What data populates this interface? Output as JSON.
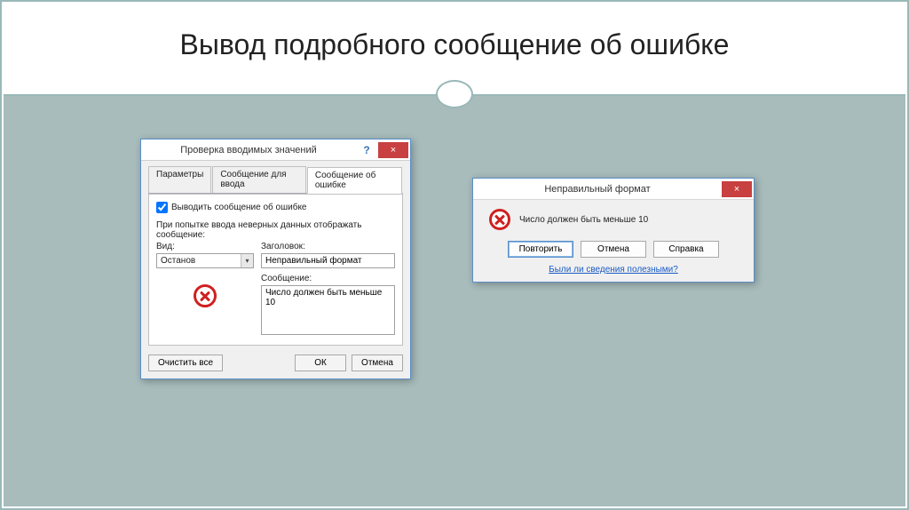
{
  "slide": {
    "title": "Вывод подробного сообщение об ошибке"
  },
  "dialog1": {
    "title": "Проверка вводимых значений",
    "help": "?",
    "close": "×",
    "tabs": {
      "params": "Параметры",
      "input_msg": "Сообщение для ввода",
      "error_msg": "Сообщение об ошибке"
    },
    "show_error_label": "Выводить сообщение об ошибке",
    "subheading": "При попытке ввода неверных данных отображать сообщение:",
    "type_label": "Вид:",
    "type_value": "Останов",
    "title_label": "Заголовок:",
    "title_value": "Неправильный формат",
    "msg_label": "Сообщение:",
    "msg_value": "Число должен быть меньше 10",
    "clear_all": "Очистить все",
    "ok": "ОК",
    "cancel": "Отмена"
  },
  "dialog2": {
    "title": "Неправильный формат",
    "close": "×",
    "message": "Число должен быть меньше 10",
    "retry": "Повторить",
    "cancel": "Отмена",
    "help": "Справка",
    "helpful_link": "Были ли сведения полезными?"
  }
}
